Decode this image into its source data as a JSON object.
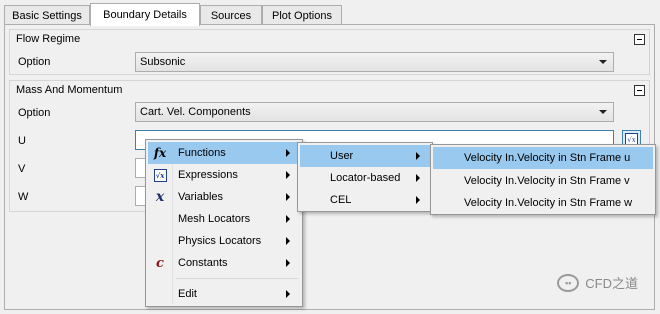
{
  "tabs": [
    "Basic Settings",
    "Boundary Details",
    "Sources",
    "Plot Options"
  ],
  "flow_regime": {
    "title": "Flow Regime",
    "option_label": "Option",
    "option_value": "Subsonic"
  },
  "mass_momentum": {
    "title": "Mass And Momentum",
    "option_label": "Option",
    "option_value": "Cart. Vel. Components",
    "u_label": "U",
    "v_label": "V",
    "w_label": "W"
  },
  "context_menu": {
    "items": [
      {
        "icon": "function-icon",
        "glyph": "fx",
        "label": "Functions"
      },
      {
        "icon": "expression-icon",
        "glyph": "√x",
        "label": "Expressions"
      },
      {
        "icon": "variable-icon",
        "glyph": "x",
        "label": "Variables"
      },
      {
        "icon": "",
        "glyph": "",
        "label": "Mesh Locators"
      },
      {
        "icon": "",
        "glyph": "",
        "label": "Physics Locators"
      },
      {
        "icon": "constant-icon",
        "glyph": "c",
        "label": "Constants"
      },
      {
        "icon": "",
        "glyph": "",
        "label": "Edit"
      }
    ]
  },
  "functions_submenu": {
    "items": [
      "User",
      "Locator-based",
      "CEL"
    ]
  },
  "user_submenu": {
    "items": [
      "Velocity In.Velocity in Stn Frame u",
      "Velocity In.Velocity in Stn Frame v",
      "Velocity In.Velocity in Stn Frame w"
    ]
  },
  "watermark": {
    "text": "CFD之道"
  }
}
